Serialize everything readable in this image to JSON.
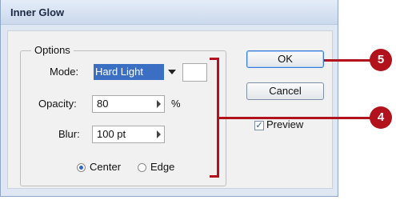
{
  "dialog": {
    "title": "Inner Glow",
    "options_group_label": "Options",
    "mode": {
      "label": "Mode:",
      "value": "Hard Light"
    },
    "opacity": {
      "label": "Opacity:",
      "value": "80",
      "unit": "%"
    },
    "blur": {
      "label": "Blur:",
      "value": "100 pt"
    },
    "radio": {
      "center_label": "Center",
      "edge_label": "Edge",
      "selected": "Center"
    },
    "buttons": {
      "ok_label": "OK",
      "cancel_label": "Cancel"
    },
    "preview": {
      "label": "Preview",
      "checked": true
    }
  },
  "callouts": {
    "ok_callout": "5",
    "options_callout": "4"
  },
  "colors": {
    "callout": "#b1121b",
    "selection": "#3a6fc4"
  }
}
